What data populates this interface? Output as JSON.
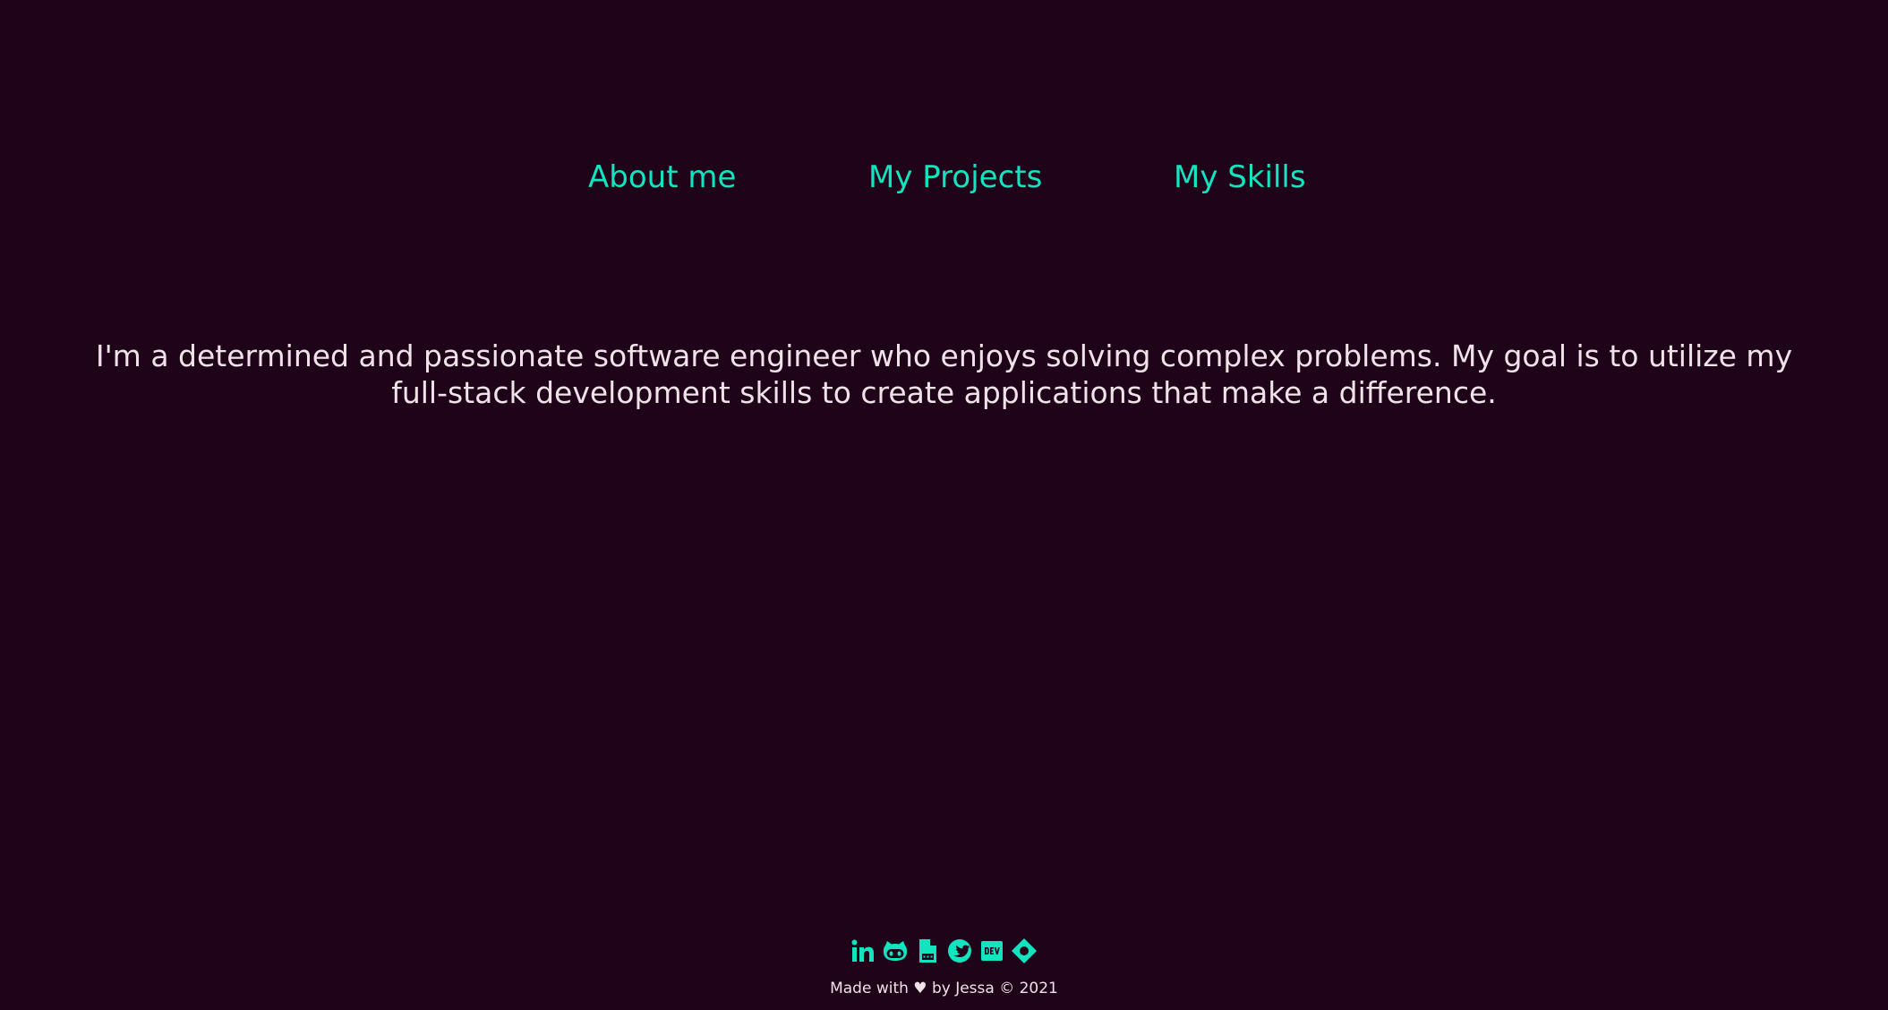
{
  "nav": {
    "items": [
      {
        "label": "About me"
      },
      {
        "label": "My Projects"
      },
      {
        "label": "My Skills"
      }
    ]
  },
  "intro": {
    "line1": "I'm a determined and passionate software engineer who enjoys solving complex problems. My goal is to utilize my",
    "line2": "full-stack development skills to create applications that make a difference."
  },
  "socials": [
    {
      "icon": "linkedin-icon"
    },
    {
      "icon": "github-icon"
    },
    {
      "icon": "resume-pdf-icon"
    },
    {
      "icon": "twitter-icon"
    },
    {
      "icon": "dev-icon"
    },
    {
      "icon": "codesignal-icon"
    }
  ],
  "footer": {
    "text": "Made with ♥ by Jessa © 2021"
  },
  "colors": {
    "background": "#1f0318",
    "accent": "#14e3c0",
    "text": "#efe2e9"
  }
}
